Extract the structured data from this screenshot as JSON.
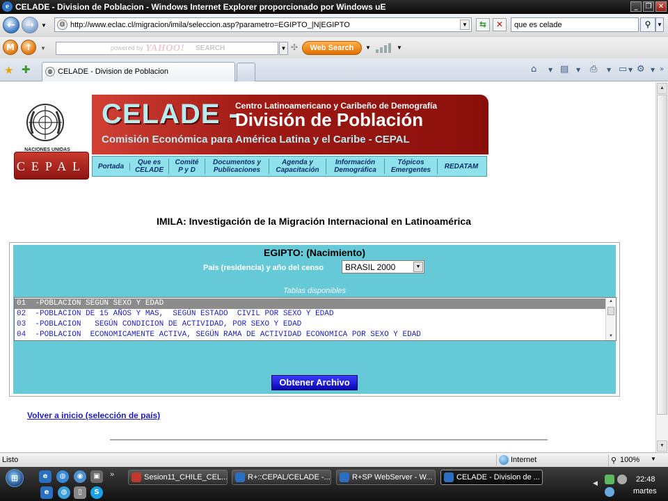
{
  "window": {
    "title": "CELADE - Division de Poblacion - Windows Internet Explorer proporcionado por Windows uE",
    "controls": [
      "minimize-icon",
      "restore-icon",
      "close-icon"
    ]
  },
  "addressbar": {
    "url": "http://www.eclac.cl/migracion/imila/seleccion.asp?parametro=EGIPTO_|N|EGIPTO",
    "search_value": "que es celade"
  },
  "yahoo_toolbar": {
    "powered_by": "powered by",
    "brand": "YAHOO!",
    "search_word": "SEARCH",
    "web_search_label": "Web Search"
  },
  "tab": {
    "title": "CELADE - Division de Poblacion"
  },
  "banner": {
    "celade": "CELADE -",
    "line1": "Centro Latinoamericano y Caribeño de Demografía",
    "line2": "División de Población",
    "line3": "Comisión Económica para América Latina y el Caribe - CEPAL",
    "un_caption": "NACIONES UNIDAS",
    "cepal": "CEPAL",
    "nav": [
      "Portada",
      "Que es\nCELADE",
      "Comité\nP y D",
      "Documentos y\nPublicaciones",
      "Agenda y\nCapacitación",
      "Información\nDemográfica",
      "Tópicos\nEmergentes",
      "REDATAM"
    ]
  },
  "page": {
    "heading": "IMILA: Investigación de la Migración Internacional en Latinoamérica",
    "panel_title": "EGIPTO: (Nacimiento)",
    "census_label": "País (residencia) y año del censo",
    "census_selected": "BRASIL 2000",
    "tables_label": "Tablas disponibles",
    "tables": [
      "01  -POBLACION SEGÚN SEXO Y EDAD",
      "02  -POBLACION DE 15 AÑOS Y MAS,  SEGÚN ESTADO  CIVIL POR SEXO Y EDAD",
      "03  -POBLACION   SEGÚN CONDICION DE ACTIVIDAD, POR SEXO Y EDAD",
      "04  -POBLACION  ECONOMICAMENTE ACTIVA, SEGÚN RAMA DE ACTIVIDAD ECONOMICA POR SEXO Y EDAD"
    ],
    "selected_index": 0,
    "obtain_button": "Obtener Archivo",
    "back_link": "Volver a inicio (selección de país)"
  },
  "statusbar": {
    "status": "Listo",
    "zone": "Internet",
    "zoom": "100%"
  },
  "taskbar": {
    "buttons": [
      "Sesion11_CHILE_CEL...",
      "R+::CEPAL/CELADE -...",
      "R+SP WebServer - W...",
      "CELADE - Division de ..."
    ],
    "active_index": 3,
    "time": "22:48",
    "day": "martes"
  },
  "colors": {
    "panel_bg": "#66c9d8",
    "banner_red": "#a01a14",
    "nav_bg": "#8fe2ec",
    "list_text": "#1c1ccc",
    "button_blue": "#0707b0"
  }
}
